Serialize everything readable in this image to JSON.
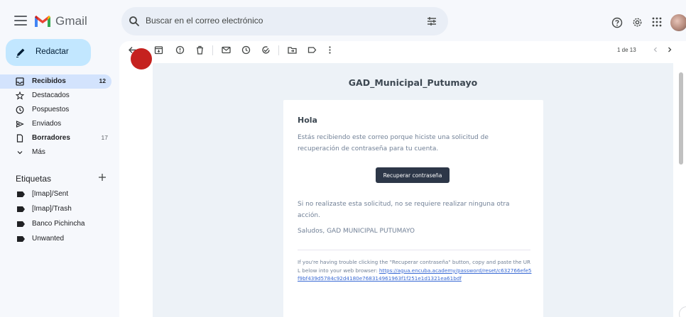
{
  "app": {
    "name": "Gmail"
  },
  "search": {
    "placeholder": "Buscar en el correo electrónico"
  },
  "compose": {
    "label": "Redactar"
  },
  "sidebar": {
    "items": [
      {
        "label": "Recibidos",
        "count": "12",
        "icon": "inbox-icon"
      },
      {
        "label": "Destacados",
        "count": "",
        "icon": "star-icon"
      },
      {
        "label": "Pospuestos",
        "count": "",
        "icon": "clock-icon"
      },
      {
        "label": "Enviados",
        "count": "",
        "icon": "send-icon"
      },
      {
        "label": "Borradores",
        "count": "17",
        "icon": "draft-icon"
      },
      {
        "label": "Más",
        "count": "",
        "icon": "chevron-down-icon"
      }
    ],
    "labels_title": "Etiquetas",
    "labels": [
      "[Imap]/Sent",
      "[Imap]/Trash",
      "Banco Pichincha",
      "Unwanted"
    ]
  },
  "toolbar": {
    "pagination": "1 de 13",
    "icons": [
      "back-icon",
      "archive-icon",
      "report-spam-icon",
      "delete-icon",
      "mark-unread-icon",
      "snooze-icon",
      "add-task-icon",
      "move-to-icon",
      "label-icon",
      "more-icon"
    ]
  },
  "email": {
    "brand": "GAD_Municipal_Putumayo",
    "heading": "Hola",
    "intro": "Estás recibiendo este correo porque hiciste una solicitud de recuperación de contraseña para tu cuenta.",
    "button_label": "Recuperar contraseña",
    "no_request": "Si no realizaste esta solicitud, no se requiere realizar ninguna otra acción.",
    "signature": "Saludos, GAD MUNICIPAL PUTUMAYO",
    "trouble_text": "If you're having trouble clicking the \"Recuperar contraseña\" button, copy and paste the URL below into your web browser: ",
    "reset_url": "https://agua.encuba.academy/password/reset/c632766efe5f9bf439d5784c92d4180e768314961963f1f251e1d1321ea61bdf"
  },
  "colors": {
    "background": "#f6f8fc",
    "compose": "#c2e7ff",
    "active_nav": "#d3e3fd",
    "email_button": "#2d3748",
    "link": "#3869d4"
  }
}
